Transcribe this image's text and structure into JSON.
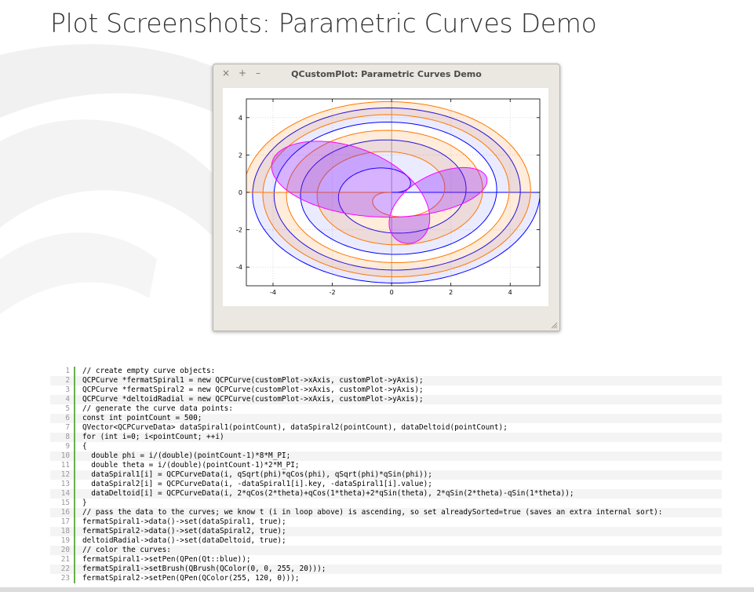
{
  "page": {
    "title": "Plot Screenshots: Parametric Curves Demo"
  },
  "window": {
    "title": "QCustomPlot: Parametric Curves Demo",
    "close_glyph": "×",
    "add_glyph": "+",
    "minimize_glyph": "–"
  },
  "plot": {
    "x_range": [
      -4.9,
      5.0
    ],
    "y_range": [
      -5.0,
      5.0
    ],
    "x_ticks": [
      -4,
      -2,
      0,
      2,
      4
    ],
    "y_ticks": [
      4,
      2,
      0,
      -2,
      -4
    ],
    "spiral1_color": "#0000ff",
    "spiral1_fill": "rgba(0,0,255,0.08)",
    "spiral2_color": "#ff7800",
    "spiral2_fill": "rgba(255,120,0,0.14)",
    "deltoid_color": "#ff00ff",
    "deltoid_fill": "rgba(120,0,255,0.30)",
    "zero_line_color": "#999999",
    "grid": true
  },
  "code": {
    "lines": [
      "// create empty curve objects:",
      "QCPCurve *fermatSpiral1 = new QCPCurve(customPlot->xAxis, customPlot->yAxis);",
      "QCPCurve *fermatSpiral2 = new QCPCurve(customPlot->xAxis, customPlot->yAxis);",
      "QCPCurve *deltoidRadial = new QCPCurve(customPlot->xAxis, customPlot->yAxis);",
      "// generate the curve data points:",
      "const int pointCount = 500;",
      "QVector<QCPCurveData> dataSpiral1(pointCount), dataSpiral2(pointCount), dataDeltoid(pointCount);",
      "for (int i=0; i<pointCount; ++i)",
      "{",
      "  double phi = i/(double)(pointCount-1)*8*M_PI;",
      "  double theta = i/(double)(pointCount-1)*2*M_PI;",
      "  dataSpiral1[i] = QCPCurveData(i, qSqrt(phi)*qCos(phi), qSqrt(phi)*qSin(phi));",
      "  dataSpiral2[i] = QCPCurveData(i, -dataSpiral1[i].key, -dataSpiral1[i].value);",
      "  dataDeltoid[i] = QCPCurveData(i, 2*qCos(2*theta)+qCos(1*theta)+2*qSin(theta), 2*qSin(2*theta)-qSin(1*theta));",
      "}",
      "// pass the data to the curves; we know t (i in loop above) is ascending, so set alreadySorted=true (saves an extra internal sort):",
      "fermatSpiral1->data()->set(dataSpiral1, true);",
      "fermatSpiral2->data()->set(dataSpiral2, true);",
      "deltoidRadial->data()->set(dataDeltoid, true);",
      "// color the curves:",
      "fermatSpiral1->setPen(QPen(Qt::blue));",
      "fermatSpiral1->setBrush(QBrush(QColor(0, 0, 255, 20)));",
      "fermatSpiral2->setPen(QPen(QColor(255, 120, 0)));"
    ]
  }
}
